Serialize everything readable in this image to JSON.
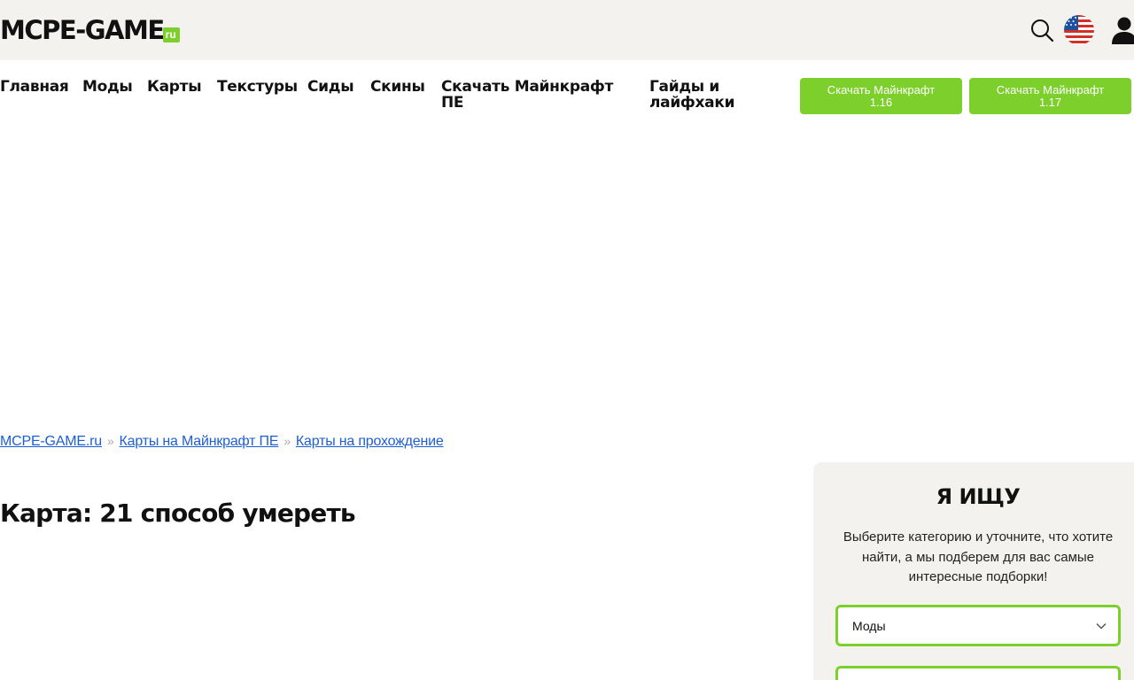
{
  "header": {
    "logo_main": "MCPE-GAME",
    "logo_suffix": "ru"
  },
  "icons": {
    "search": "search-icon",
    "language_flag": "us-flag-icon",
    "user": "user-icon"
  },
  "nav": {
    "items": [
      {
        "label": "Главная"
      },
      {
        "label": "Моды"
      },
      {
        "label": "Карты"
      },
      {
        "label": "Текстуры"
      },
      {
        "label": "Сиды"
      },
      {
        "label": "Скины"
      },
      {
        "label": "Скачать Майнкрафт ПЕ"
      },
      {
        "label": "Гайды и лайфхаки"
      }
    ],
    "buttons": [
      {
        "label": "Скачать Майнкрафт 1.16"
      },
      {
        "label": "Скачать Майнкрафт 1.17"
      }
    ]
  },
  "breadcrumb": {
    "items": [
      {
        "label": "MCPE-GAME.ru"
      },
      {
        "label": "Карты на Майнкрафт ПЕ"
      },
      {
        "label": "Карты на прохождение"
      }
    ],
    "separator": "»"
  },
  "page_title": "Карта: 21 способ умереть",
  "sidebar": {
    "title": "Я ИЩУ",
    "text": "Выберите категорию и уточните, что хотите найти, а мы подберем для вас самые интересные подборки!",
    "category_select": {
      "value": "Моды"
    }
  },
  "colors": {
    "accent": "#7dcf2c",
    "header_bg": "#f3f2ee",
    "link": "#1c5fd4"
  }
}
